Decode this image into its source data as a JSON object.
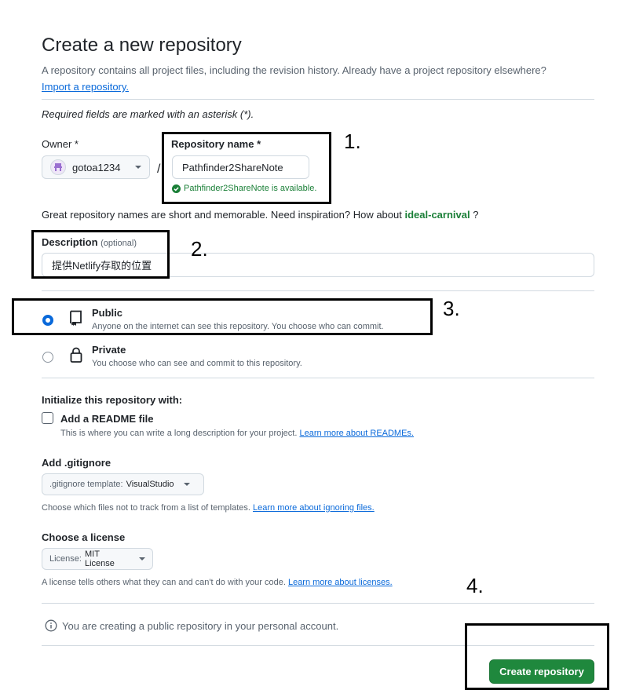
{
  "header": {
    "title": "Create a new repository",
    "subtitle": "A repository contains all project files, including the revision history. Already have a project repository elsewhere?",
    "import_link": "Import a repository."
  },
  "required_note": "Required fields are marked with an asterisk (*).",
  "owner": {
    "label": "Owner *",
    "value": "gotoa1234"
  },
  "slash": "/",
  "repo_name": {
    "label": "Repository name *",
    "value": "Pathfinder2ShareNote",
    "availability": "Pathfinder2ShareNote is available."
  },
  "suggestion": {
    "text": "Great repository names are short and memorable. Need inspiration? How about",
    "name": "ideal-carnival",
    "suffix": "?"
  },
  "description": {
    "label": "Description",
    "optional": "(optional)",
    "value": "提供Netlify存取的位置"
  },
  "visibility": {
    "public": {
      "title": "Public",
      "desc": "Anyone on the internet can see this repository. You choose who can commit.",
      "selected": true
    },
    "private": {
      "title": "Private",
      "desc": "You choose who can see and commit to this repository.",
      "selected": false
    }
  },
  "init": {
    "heading": "Initialize this repository with:",
    "readme_label": "Add a README file",
    "readme_desc": "This is where you can write a long description for your project.",
    "readme_link": "Learn more about READMEs."
  },
  "gitignore": {
    "heading": "Add .gitignore",
    "prefix": ".gitignore template:",
    "value": "VisualStudio",
    "desc": "Choose which files not to track from a list of templates.",
    "link": "Learn more about ignoring files."
  },
  "license": {
    "heading": "Choose a license",
    "prefix": "License:",
    "value": "MIT License",
    "desc": "A license tells others what they can and can't do with your code.",
    "link": "Learn more about licenses."
  },
  "info_text": "You are creating a public repository in your personal account.",
  "create_button": "Create repository",
  "annotations": {
    "n1": "1.",
    "n2": "2.",
    "n3": "3.",
    "n4": "4."
  },
  "colors": {
    "accent": "#0969da",
    "success": "#1a7f37",
    "button": "#1f883d"
  }
}
